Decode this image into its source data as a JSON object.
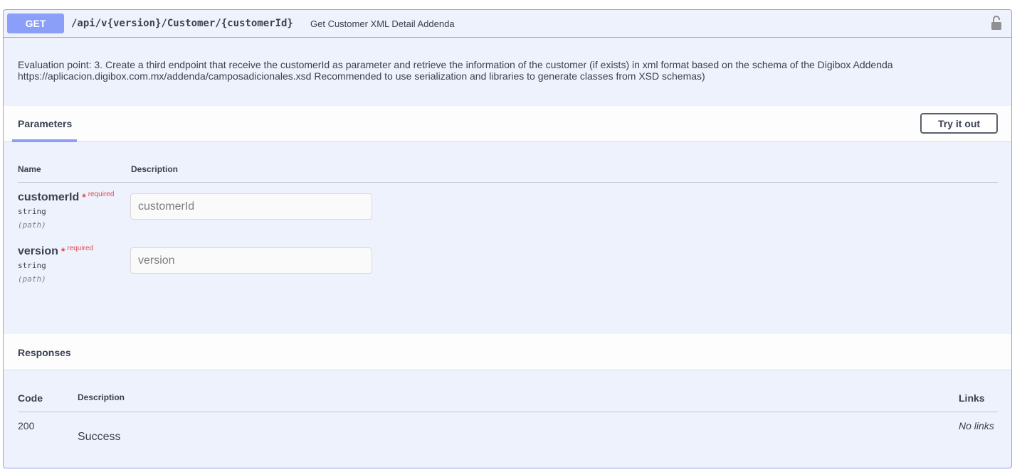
{
  "summary": {
    "method": "GET",
    "path": "/api/v{version}/Customer/{customerId}",
    "description": "Get Customer XML Detail Addenda"
  },
  "description": {
    "line1": "Evaluation point: 3. Create a third endpoint that receive the customerId as parameter and retrieve the information of the customer (if exists) in xml format based on the schema of the Digibox Addenda",
    "line2": "https://aplicacion.digibox.com.mx/addenda/camposadicionales.xsd Recommended to use serialization and libraries to generate classes from XSD schemas)"
  },
  "parameters": {
    "tab_label": "Parameters",
    "try_button": "Try it out",
    "col_name": "Name",
    "col_description": "Description",
    "items": [
      {
        "name": "customerId",
        "required_star": "*",
        "required_text": "required",
        "type": "string",
        "in": "(path)",
        "placeholder": "customerId",
        "value": ""
      },
      {
        "name": "version",
        "required_star": "*",
        "required_text": "required",
        "type": "string",
        "in": "(path)",
        "placeholder": "version",
        "value": ""
      }
    ]
  },
  "responses": {
    "title": "Responses",
    "col_code": "Code",
    "col_description": "Description",
    "col_links": "Links",
    "rows": [
      {
        "code": "200",
        "description": "Success",
        "links": "No links"
      }
    ]
  },
  "colors": {
    "method_get": "#8b9ff8",
    "block_bg": "#eef2fc",
    "border": "#8fa4f0",
    "required": "#e5484d"
  },
  "icons": {
    "lock": "unlocked-padlock-icon"
  }
}
